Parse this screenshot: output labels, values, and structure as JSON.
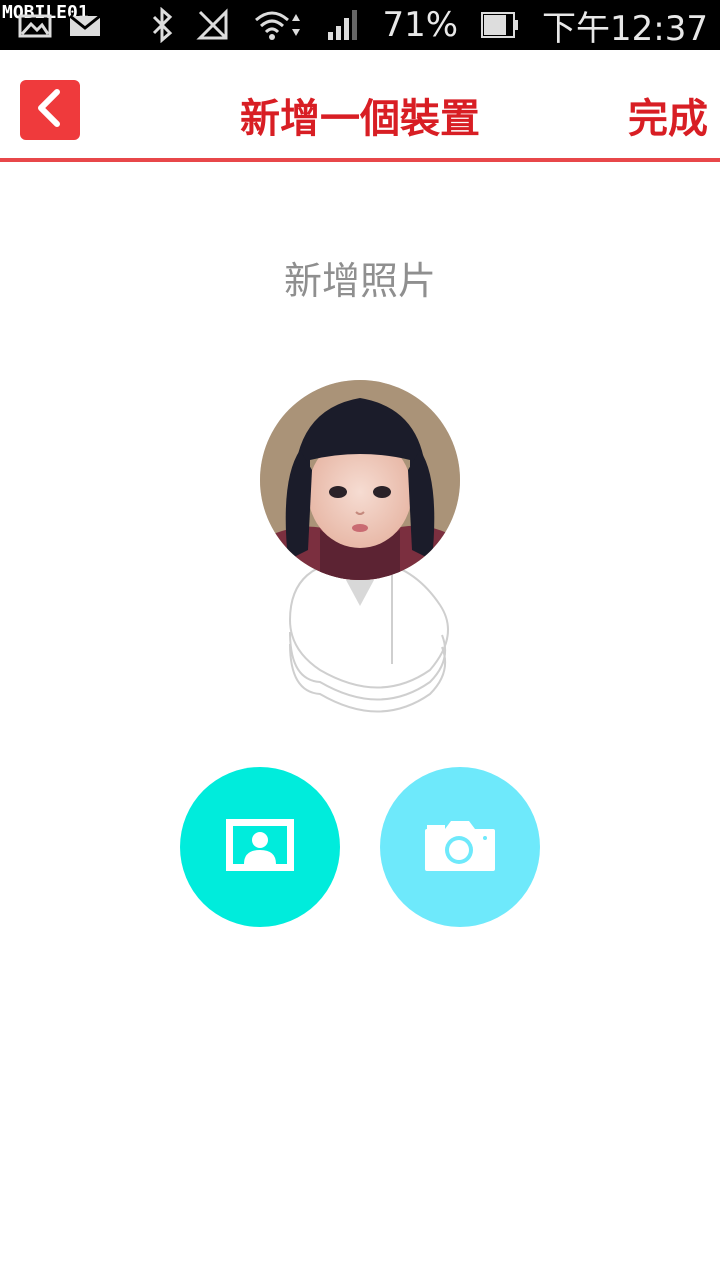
{
  "status_bar": {
    "watermark": "MOBILE01",
    "battery": "71%",
    "time": "下午12:37"
  },
  "header": {
    "title": "新增一個裝置",
    "done_label": "完成"
  },
  "main": {
    "subtitle": "新增照片"
  },
  "colors": {
    "accent": "#d81e24",
    "back_button": "#ef3a3c",
    "gallery_button": "#00ecdc",
    "camera_button": "#6ee9fb"
  },
  "icons": [
    "image-icon",
    "email-icon",
    "bluetooth-icon",
    "no-signal-icon",
    "wifi-icon",
    "signal-bars-icon",
    "battery-icon",
    "chevron-left-icon",
    "gallery-icon",
    "camera-icon"
  ]
}
